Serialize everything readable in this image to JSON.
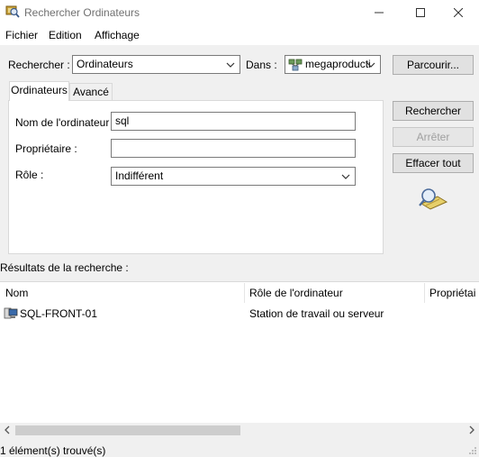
{
  "window": {
    "title": "Rechercher Ordinateurs",
    "minimize_glyph": "—",
    "maximize_glyph": "☐",
    "close_glyph": "✕"
  },
  "menu": [
    "Fichier",
    "Edition",
    "Affichage"
  ],
  "search": {
    "label": "Rechercher :",
    "value": "Ordinateurs",
    "in_label": "Dans :",
    "in_value": "megaproducti",
    "browse_label": "Parcourir..."
  },
  "tabs": [
    {
      "label": "Ordinateurs",
      "active": true
    },
    {
      "label": "Avancé",
      "active": false
    }
  ],
  "form": {
    "name_label": "Nom de l'ordinateur :",
    "name_value": "sql",
    "owner_label": "Propriétaire :",
    "owner_value": "",
    "role_label": "Rôle :",
    "role_value": "Indifférent"
  },
  "actions": {
    "search": "Rechercher",
    "stop": "Arrêter",
    "clear": "Effacer tout"
  },
  "results": {
    "label": "Résultats de la recherche :",
    "columns": [
      "Nom",
      "Rôle de l'ordinateur",
      "Propriétai"
    ],
    "rows": [
      {
        "name": "SQL-FRONT-01",
        "role": "Station de travail ou serveur",
        "owner": ""
      }
    ]
  },
  "status": "1 élément(s) trouvé(s)",
  "icons": {
    "title": "find-computers-icon",
    "domain": "domain-icon",
    "search_graphic": "magnifier-icon",
    "computer": "computer-icon"
  }
}
